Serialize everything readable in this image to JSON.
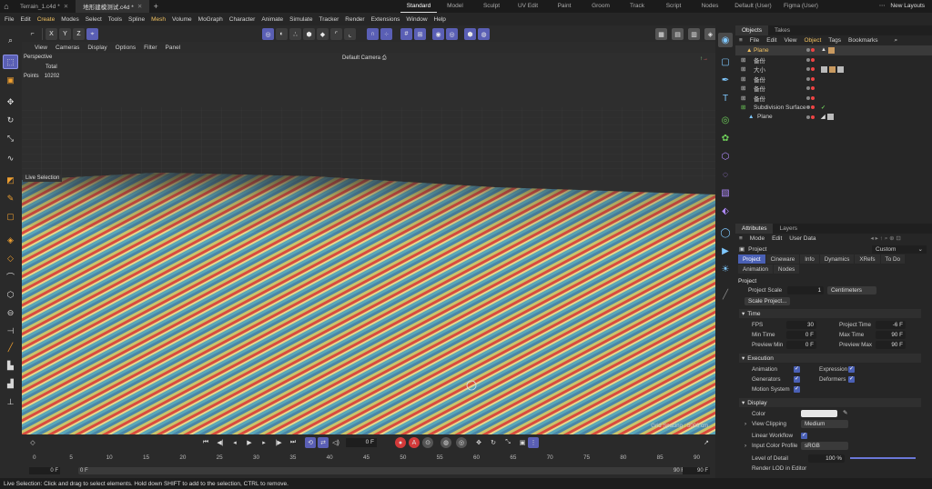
{
  "title_bar": {
    "file_tabs": [
      {
        "label": "Terrain_1.c4d *",
        "active": false
      },
      {
        "label": "地形建模测试.c4d *",
        "active": true
      }
    ],
    "layouts": [
      "Standard",
      "Model",
      "Sculpt",
      "UV Edit",
      "Paint",
      "Groom",
      "Track",
      "Script",
      "Nodes",
      "Default (User)",
      "Figma (User)"
    ],
    "active_layout": "Standard",
    "new_layouts_label": "New Layouts"
  },
  "menu_bar": [
    "File",
    "Edit",
    "Create",
    "Modes",
    "Select",
    "Tools",
    "Spline",
    "Mesh",
    "Volume",
    "MoGraph",
    "Character",
    "Animate",
    "Simulate",
    "Tracker",
    "Render",
    "Extensions",
    "Window",
    "Help"
  ],
  "toolbar": {
    "axis_labels": [
      "X",
      "Y",
      "Z"
    ],
    "colors": {
      "active": "#5a5fb5",
      "panel": "#2b2b2b"
    }
  },
  "viewport": {
    "menu": [
      "View",
      "Cameras",
      "Display",
      "Options",
      "Filter",
      "Panel"
    ],
    "name": "Perspective",
    "camera": "Default Camera",
    "stats_header": "Total",
    "stats_label": "Points",
    "stats_value": "10202",
    "live_selection": "Live Selection",
    "grid_spacing": "Grid Spacing : 5000 cm"
  },
  "objects_panel": {
    "tabs": [
      "Objects",
      "Takes"
    ],
    "menu": [
      "File",
      "Edit",
      "View",
      "Object",
      "Tags",
      "Bookmarks"
    ],
    "items": [
      {
        "name": "Plane",
        "selected": true
      },
      {
        "name": "备份",
        "selected": false
      },
      {
        "name": "大小",
        "selected": false
      },
      {
        "name": "备份",
        "selected": false
      },
      {
        "name": "备份",
        "selected": false
      },
      {
        "name": "备份",
        "selected": false
      },
      {
        "name": "Subdivision Surface",
        "selected": false
      },
      {
        "name": "Plane",
        "selected": false
      }
    ]
  },
  "attributes_panel": {
    "tabs": [
      "Attributes",
      "Layers"
    ],
    "menu": [
      "Mode",
      "Edit",
      "User Data"
    ],
    "object_label": "Project",
    "preset": "Custom",
    "tab_row1": [
      "Project",
      "Cineware",
      "Info",
      "Dynamics",
      "XRefs"
    ],
    "tab_row2": [
      "To Do",
      "Animation",
      "Nodes"
    ],
    "section_title": "Project",
    "project_scale_label": "Project Scale",
    "project_scale_value": "1",
    "project_scale_unit": "Centimeters",
    "scale_project_button": "Scale Project...",
    "time_section": "Time",
    "fps_label": "FPS",
    "fps_value": "30",
    "project_time_label": "Project Time",
    "project_time_value": "-6 F",
    "min_time_label": "Min Time",
    "min_time_value": "0 F",
    "max_time_label": "Max Time",
    "max_time_value": "90 F",
    "preview_min_label": "Preview Min",
    "preview_min_value": "0 F",
    "preview_max_label": "Preview Max",
    "preview_max_value": "90 F",
    "execution_section": "Execution",
    "animation_label": "Animation",
    "expression_label": "Expression",
    "generators_label": "Generators",
    "deformers_label": "Deformers",
    "motion_system_label": "Motion System",
    "display_section": "Display",
    "color_label": "Color",
    "view_clipping_label": "View Clipping",
    "view_clipping_value": "Medium",
    "linear_workflow_label": "Linear Workflow",
    "input_color_profile_label": "Input Color Profile",
    "input_color_profile_value": "sRGB",
    "level_of_detail_label": "Level of Detail",
    "level_of_detail_value": "100 %",
    "level_of_detail_percent": 100,
    "render_lod_label": "Render LOD in Editor"
  },
  "timeline": {
    "current_frame": "0 F",
    "ticks": [
      "0",
      "5",
      "10",
      "15",
      "20",
      "25",
      "30",
      "35",
      "40",
      "45",
      "50",
      "55",
      "60",
      "65",
      "70",
      "75",
      "80",
      "85",
      "90"
    ],
    "range_start": "0 F",
    "range_start2": "0 F",
    "range_end": "90 F",
    "range_end2": "90 F"
  },
  "status_bar": "Live Selection: Click and drag to select elements. Hold down SHIFT to add to the selection, CTRL to remove."
}
